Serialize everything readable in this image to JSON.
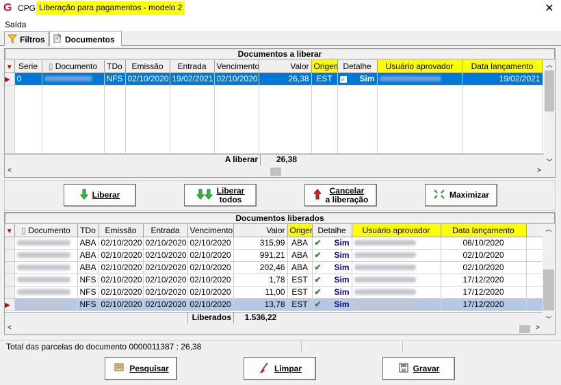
{
  "window": {
    "app": "CPG",
    "title": "Liberação para pagamentos - modelo 2",
    "close": "✕"
  },
  "menu": {
    "saida": "Saída"
  },
  "tabs": [
    {
      "label": "Filtros"
    },
    {
      "label": "Documentos"
    }
  ],
  "top": {
    "title": "Documentos a liberar",
    "headers": [
      "Serie",
      "Documento",
      "TDo",
      "Emissão",
      "Entrada",
      "Vencimento",
      "Valor",
      "Origem",
      "Detalhe",
      "Usuário aprovador",
      "Data lançamento"
    ],
    "rows": [
      {
        "serie": "0",
        "tdo": "NFS",
        "emissao": "02/10/2020",
        "entrada": "19/02/2021",
        "vencimento": "02/10/2020",
        "valor": "26,38",
        "origem": "EST",
        "detalhe": "Sim",
        "data": "19/02/2021"
      }
    ],
    "footer_label": "A liberar",
    "footer_value": "26,38"
  },
  "buttons": {
    "liberar": "Liberar",
    "liberar_todos_1": "Liberar",
    "liberar_todos_2": "todos",
    "cancelar_1": "Cancelar",
    "cancelar_2": "a liberação",
    "maximizar": "Maximizar"
  },
  "bottom": {
    "title": "Documentos liberados",
    "headers": [
      "Documento",
      "TDo",
      "Emissão",
      "Entrada",
      "Vencimento",
      "Valor",
      "Origem",
      "Detalhe",
      "Usuário aprovador",
      "Data lançamento"
    ],
    "rows": [
      {
        "tdo": "ABA",
        "emissao": "02/10/2020",
        "entrada": "02/10/2020",
        "vencimento": "02/10/2020",
        "valor": "315,99",
        "origem": "ABA",
        "detalhe": "Sim",
        "data": "06/10/2020"
      },
      {
        "tdo": "ABA",
        "emissao": "02/10/2020",
        "entrada": "02/10/2020",
        "vencimento": "02/10/2020",
        "valor": "991,21",
        "origem": "ABA",
        "detalhe": "Sim",
        "data": "02/10/2020"
      },
      {
        "tdo": "ABA",
        "emissao": "02/10/2020",
        "entrada": "02/10/2020",
        "vencimento": "02/10/2020",
        "valor": "202,46",
        "origem": "ABA",
        "detalhe": "Sim",
        "data": "02/10/2020"
      },
      {
        "tdo": "NFS",
        "emissao": "02/10/2020",
        "entrada": "02/10/2020",
        "vencimento": "02/10/2020",
        "valor": "1,78",
        "origem": "EST",
        "detalhe": "Sim",
        "data": "17/12/2020"
      },
      {
        "tdo": "NFS",
        "emissao": "02/10/2020",
        "entrada": "02/10/2020",
        "vencimento": "02/10/2020",
        "valor": "11,00",
        "origem": "EST",
        "detalhe": "Sim",
        "data": "17/12/2020"
      },
      {
        "tdo": "NFS",
        "emissao": "02/10/2020",
        "entrada": "02/10/2020",
        "vencimento": "02/10/2020",
        "valor": "13,78",
        "origem": "EST",
        "detalhe": "Sim",
        "data": "17/12/2020"
      }
    ],
    "footer_label": "Liberados",
    "footer_value": "1.536,22"
  },
  "status": {
    "text": "Total das parcelas do documento  0000011387 :  26,38"
  },
  "actions": {
    "pesquisar": "Pesquisar",
    "limpar": "Limpar",
    "gravar": "Gravar"
  },
  "colors": {
    "highlight": "#ffff00",
    "selection": "#0078d7",
    "accent_red": "#c8102e"
  }
}
